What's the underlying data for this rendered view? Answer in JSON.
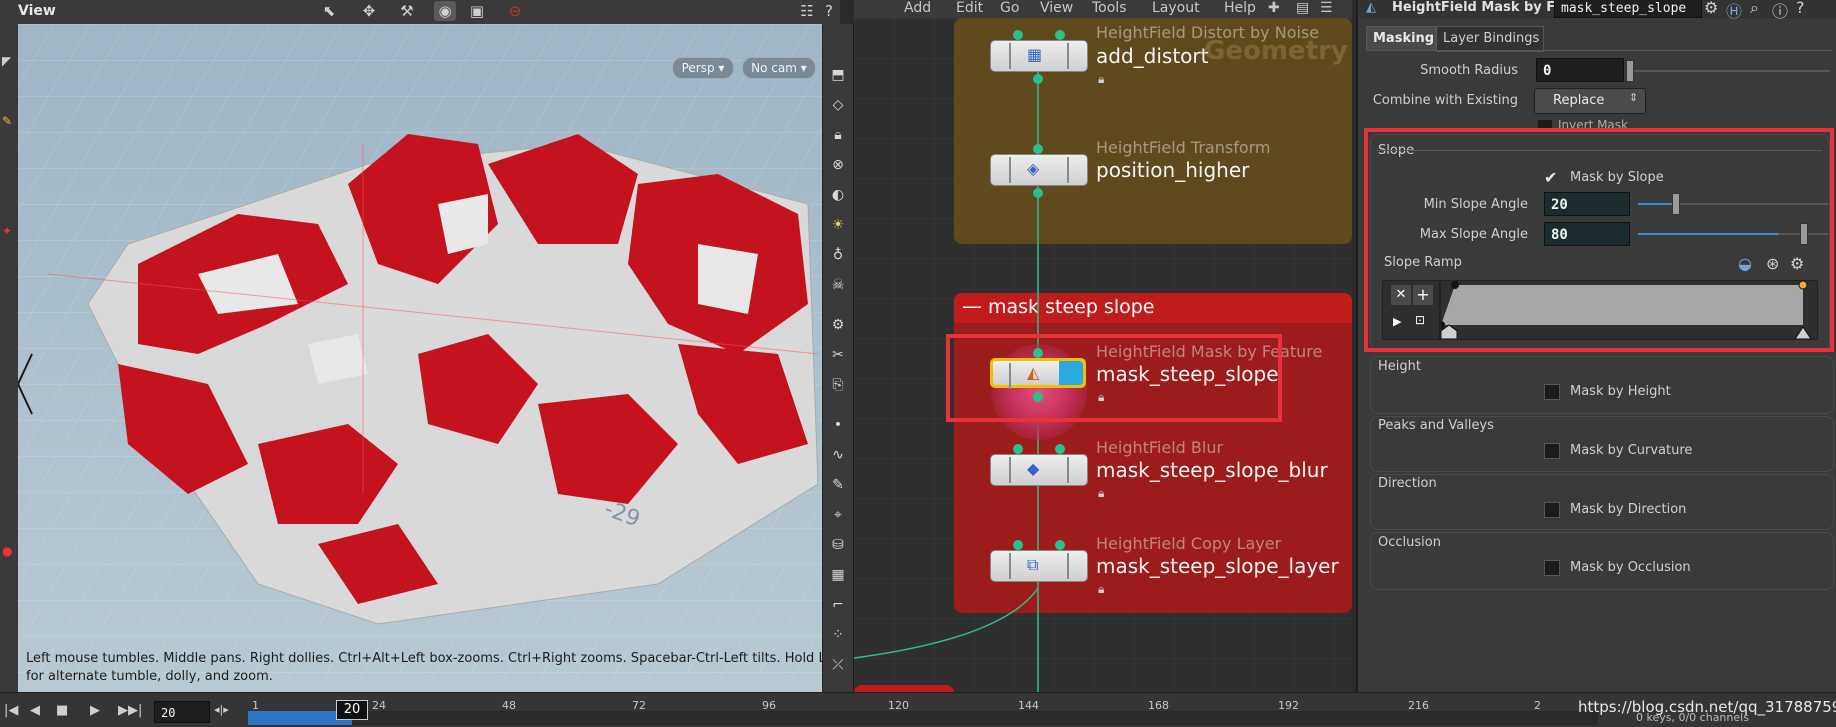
{
  "viewport": {
    "title": "View",
    "persp_label": "Persp",
    "cam_label": "No cam",
    "hint": "Left mouse tumbles. Middle pans. Right dollies. Ctrl+Alt+Left box-zooms. Ctrl+Right zooms. Spacebar-Ctrl-Left tilts. Hold L for alternate tumble, dolly, and zoom.",
    "grid_label": "-29"
  },
  "network": {
    "menu": [
      "Add",
      "Edit",
      "Go",
      "View",
      "Tools",
      "Layout",
      "Help"
    ],
    "geometry_label": "Geometry",
    "box_title": "mask steep slope",
    "nodes": [
      {
        "type": "HeightField Distort by Noise",
        "name": "add_distort"
      },
      {
        "type": "HeightField Transform",
        "name": "position_higher"
      },
      {
        "type": "HeightField Mask by Feature",
        "name": "mask_steep_slope"
      },
      {
        "type": "HeightField Blur",
        "name": "mask_steep_slope_blur"
      },
      {
        "type": "HeightField Copy Layer",
        "name": "mask_steep_slope_layer"
      }
    ]
  },
  "params": {
    "node_type": "HeightField Mask by F...",
    "node_name": "mask_steep_slope",
    "tabs": [
      "Masking",
      "Layer Bindings"
    ],
    "smooth_radius_label": "Smooth Radius",
    "smooth_radius_value": "0",
    "combine_label": "Combine with Existing",
    "combine_value": "Replace",
    "invert_label": "Invert Mask",
    "slope_group": "Slope",
    "mask_by_slope": "Mask by Slope",
    "min_slope_label": "Min Slope Angle",
    "min_slope_value": "20",
    "max_slope_label": "Max Slope Angle",
    "max_slope_value": "80",
    "slope_ramp_label": "Slope Ramp",
    "height_group": "Height",
    "mask_by_height": "Mask by Height",
    "peaks_group": "Peaks and Valleys",
    "mask_by_curvature": "Mask by Curvature",
    "direction_group": "Direction",
    "mask_by_direction": "Mask by Direction",
    "occlusion_group": "Occlusion",
    "mask_by_occlusion": "Mask by Occlusion",
    "keys_status": "0 keys, 0/0 channels"
  },
  "timeline": {
    "current_frame": "20",
    "frame_field": "20",
    "ticks": [
      "1",
      "24",
      "48",
      "72",
      "96",
      "120",
      "144",
      "168",
      "192",
      "216",
      "2"
    ],
    "watermark": "https://blog.csdn.net/qq_31788759"
  },
  "colors": {
    "accent_red": "#e8323a",
    "node_box_red": "#9c1c1c",
    "geometry_box": "#5f4a1e",
    "wire_green": "#29c08d",
    "terrain_red": "#c4121f"
  }
}
